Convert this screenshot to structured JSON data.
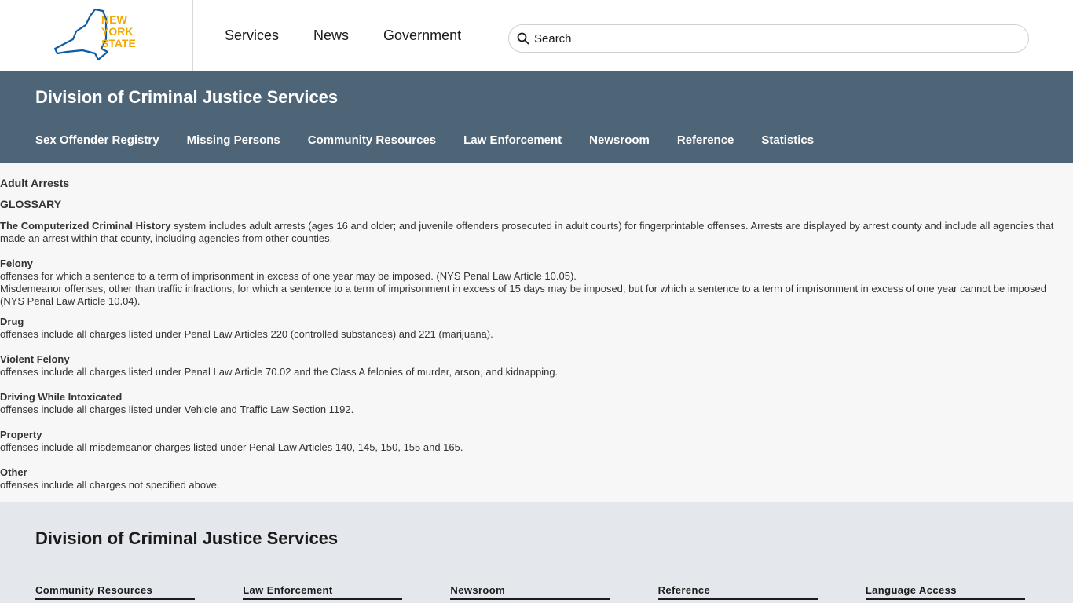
{
  "header": {
    "logo_text": [
      "NEW",
      "YORK",
      "STATE"
    ],
    "nav": [
      "Services",
      "News",
      "Government"
    ],
    "search_placeholder": "Search"
  },
  "agency": {
    "title": "Division of Criminal Justice Services",
    "nav": [
      "Sex Offender Registry",
      "Missing Persons",
      "Community Resources",
      "Law Enforcement",
      "Newsroom",
      "Reference",
      "Statistics"
    ]
  },
  "content": {
    "breadcrumb": "Adult Arrests",
    "glossary_title": "GLOSSARY",
    "intro_bold": "The Computerized Criminal History",
    "intro_rest": " system includes adult arrests (ages 16 and older; and juvenile offenders prosecuted in adult courts) for fingerprintable offenses. Arrests are displayed by arrest county and include all agencies that made an arrest within that county, including agencies from other counties.",
    "terms": [
      {
        "name": "Felony",
        "lines": [
          "offenses for which a sentence to a term of imprisonment in excess of one year may be imposed. (NYS Penal Law Article 10.05).",
          "Misdemeanor offenses, other than traffic infractions, for which a sentence to a term of imprisonment in excess of 15 days may be imposed, but for which a sentence to a term of imprisonment in excess of one year cannot be imposed (NYS Penal Law Article 10.04)."
        ]
      },
      {
        "name": "Drug",
        "lines": [
          "offenses include all charges listed under Penal Law Articles 220 (controlled substances) and 221 (marijuana)."
        ]
      },
      {
        "name": "Violent Felony",
        "lines": [
          "offenses include all charges listed under Penal Law Article 70.02 and the Class A felonies of murder, arson, and kidnapping."
        ]
      },
      {
        "name": "Driving While Intoxicated",
        "lines": [
          "offenses include all charges listed under Vehicle and Traffic Law Section 1192."
        ]
      },
      {
        "name": "Property",
        "lines": [
          "offenses include all misdemeanor charges listed under Penal Law Articles 140, 145, 150, 155 and 165."
        ]
      },
      {
        "name": "Other",
        "lines": [
          "offenses include all charges not specified above."
        ]
      }
    ]
  },
  "footer": {
    "title": "Division of Criminal Justice Services",
    "columns": [
      "Community Resources",
      "Law Enforcement",
      "Newsroom",
      "Reference",
      "Language Access"
    ]
  },
  "colors": {
    "header_bar": "#4e6477",
    "logo_gold": "#f2a900",
    "logo_blue": "#0f5ba7",
    "footer_bg": "#e4e8ec"
  }
}
